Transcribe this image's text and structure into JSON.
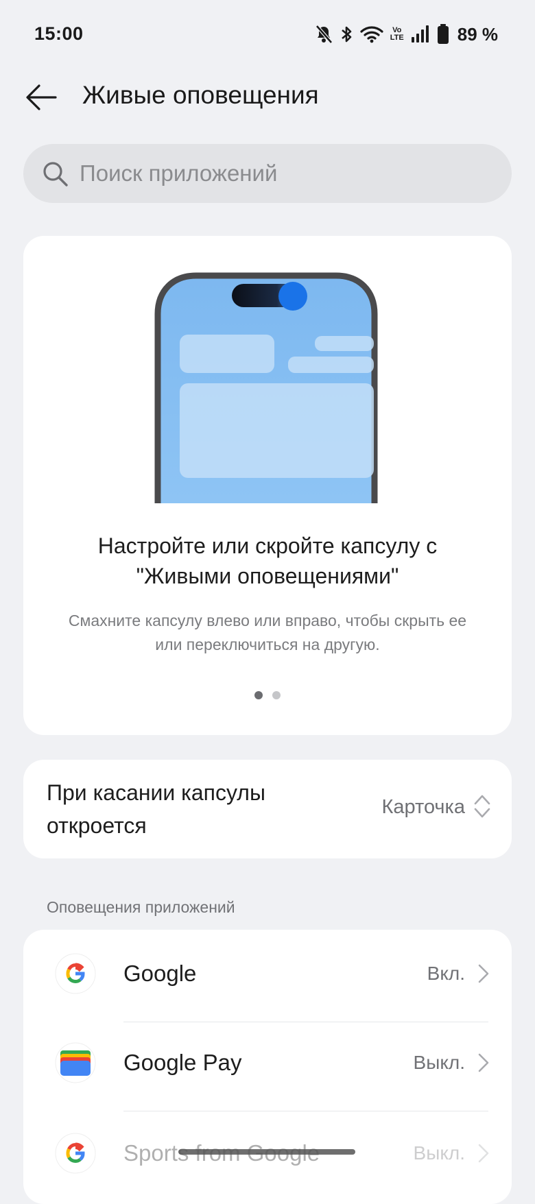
{
  "status_bar": {
    "time": "15:00",
    "volte_top": "Vo",
    "volte_bottom": "LTE",
    "battery": "89 %",
    "icons": [
      "bell-off-icon",
      "bluetooth-icon",
      "wifi-icon",
      "volte-icon",
      "signal-icon",
      "battery-icon"
    ]
  },
  "header": {
    "title": "Живые оповещения",
    "back_icon": "arrow-left-icon"
  },
  "search": {
    "placeholder": "Поиск приложений",
    "value": ""
  },
  "hero": {
    "title_line1": "Настройте или скройте капсулу с",
    "title_line2": "\"Живыми оповещениями\"",
    "desc_line1": "Смахните капсулу влево или вправо, чтобы скрыть ее",
    "desc_line2": "или переключиться на другую.",
    "pages": 2,
    "active_page": 1
  },
  "tap_setting": {
    "label_line1": "При касании капсулы",
    "label_line2": "откроется",
    "value": "Карточка"
  },
  "apps_section": {
    "label": "Оповещения приложений",
    "items": [
      {
        "name": "Google",
        "status": "Вкл.",
        "icon": "google-icon"
      },
      {
        "name": "Google Pay",
        "status": "Выкл.",
        "icon": "google-pay-icon"
      },
      {
        "name": "Sports from Google",
        "status": "Выкл.",
        "icon": "google-icon"
      }
    ]
  },
  "colors": {
    "background": "#f0f1f4",
    "card": "#ffffff",
    "accent_blue": "#1a73e8"
  }
}
